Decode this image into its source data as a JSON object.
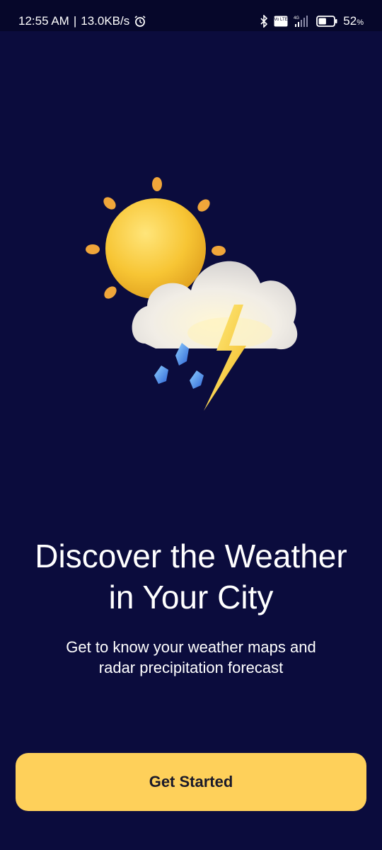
{
  "status_bar": {
    "time": "12:55 AM",
    "separator": "|",
    "network_speed": "13.0KB/s",
    "battery_percent": "52",
    "battery_level": 0.52,
    "battery_unit": "%",
    "network_type": "4G",
    "volte_label": "Vo LTE",
    "icons": [
      "alarm-icon",
      "bluetooth-icon",
      "volte-icon",
      "signal-icon",
      "battery-icon"
    ]
  },
  "onboarding": {
    "illustration": "weather-storm-sun-illustration",
    "headline_line1": "Discover the Weather",
    "headline_line2": "in Your City",
    "subtitle_line1": "Get to know your weather maps and",
    "subtitle_line2": "radar precipitation forecast",
    "cta_label": "Get Started"
  },
  "colors": {
    "background": "#0b0c3d",
    "status_bar_bg": "#06072a",
    "cta_background": "#fed05a",
    "cta_text": "#1b1a2a",
    "text_primary": "#ffffff"
  }
}
